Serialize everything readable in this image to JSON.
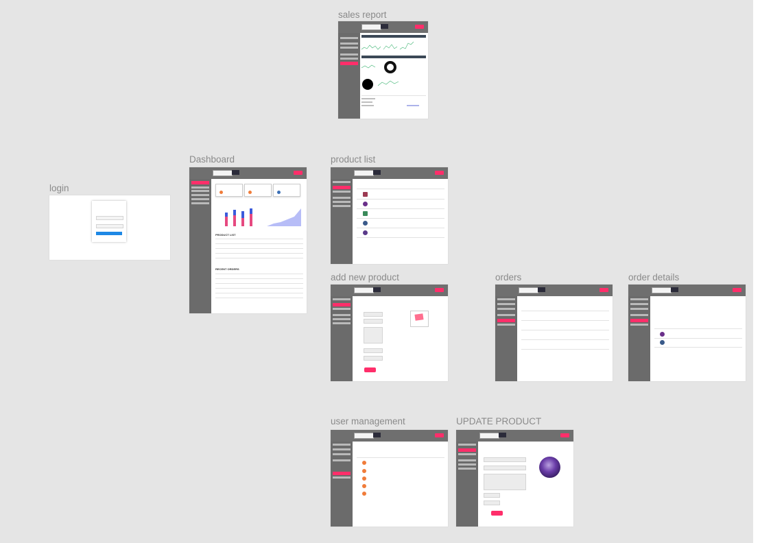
{
  "frames": {
    "sales_report": {
      "label": "sales report"
    },
    "dashboard": {
      "label": "Dashboard"
    },
    "product_list": {
      "label": "product list"
    },
    "login": {
      "label": "login"
    },
    "add_new_product": {
      "label": "add new product"
    },
    "orders": {
      "label": "orders"
    },
    "order_details": {
      "label": "order details"
    },
    "user_management": {
      "label": "user management"
    },
    "update_product": {
      "label": "UPDATE PRODUCT"
    }
  },
  "colors": {
    "canvas": "#e5e5e5",
    "sidebar": "#6b6b6b",
    "accent": "#ff2e6a",
    "chart_blue": "#3b5bdb",
    "chart_pink": "#e64980",
    "area_fill": "#b7bdf7"
  }
}
